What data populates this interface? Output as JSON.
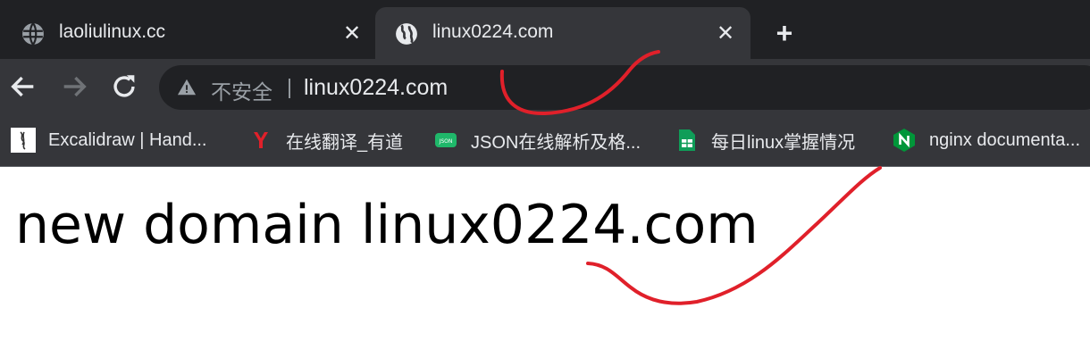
{
  "tabs": [
    {
      "title": "laoliulinux.cc",
      "active": false,
      "icon": "globe-icon"
    },
    {
      "title": "linux0224.com",
      "active": true,
      "icon": "globe-icon"
    }
  ],
  "new_tab_symbol": "+",
  "close_symbol": "✕",
  "omnibox": {
    "security_label": "不安全",
    "separator": "|",
    "url": "linux0224.com"
  },
  "bookmarks": [
    {
      "label": "Excalidraw | Hand...",
      "icon": "excalidraw-icon"
    },
    {
      "label": "在线翻译_有道",
      "icon": "youdao-icon"
    },
    {
      "label": "JSON在线解析及格...",
      "icon": "json-icon"
    },
    {
      "label": "每日linux掌握情况",
      "icon": "sheets-icon"
    },
    {
      "label": "nginx documenta...",
      "icon": "nginx-icon"
    }
  ],
  "page": {
    "heading": "new domain linux0224.com"
  },
  "colors": {
    "tab_strip": "#202124",
    "toolbar": "#35363a",
    "annotation": "#e0202a"
  }
}
